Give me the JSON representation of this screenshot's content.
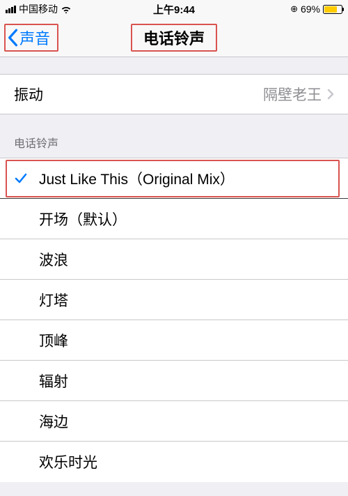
{
  "status": {
    "carrier": "中国移动",
    "time": "上午9:44",
    "battery_pct": "69%"
  },
  "nav": {
    "back_label": "声音",
    "title": "电话铃声"
  },
  "vibration": {
    "label": "振动",
    "value": "隔壁老王"
  },
  "section_header": "电话铃声",
  "ringtones": {
    "selected": "Just Like This（Original Mix）",
    "items": [
      "开场（默认）",
      "波浪",
      "灯塔",
      "顶峰",
      "辐射",
      "海边",
      "欢乐时光"
    ]
  }
}
